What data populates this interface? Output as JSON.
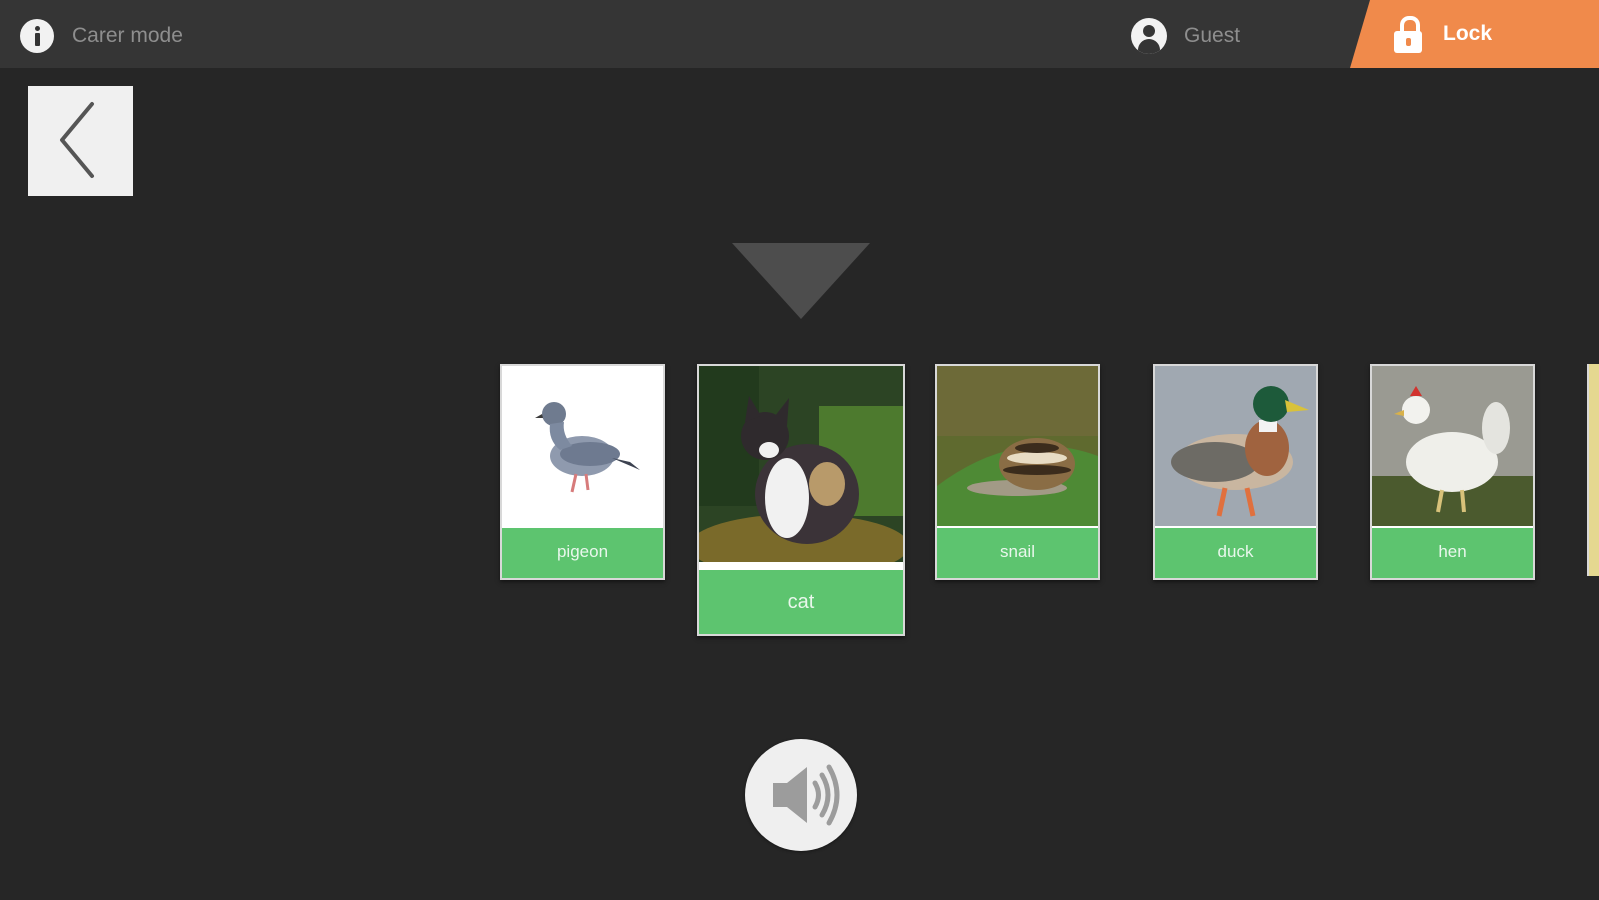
{
  "topbar": {
    "info_label": "Carer mode",
    "user_label": "Guest",
    "lock_label": "Lock"
  },
  "cards": [
    {
      "label": "pigeon",
      "icon": "pigeon-photo"
    },
    {
      "label": "cat",
      "icon": "cat-photo",
      "selected": true
    },
    {
      "label": "snail",
      "icon": "snail-photo"
    },
    {
      "label": "duck",
      "icon": "duck-photo"
    },
    {
      "label": "hen",
      "icon": "hen-photo"
    }
  ],
  "colors": {
    "background": "#262626",
    "topbar": "#353535",
    "lock_accent": "#f08a4b",
    "caption_green": "#5dc46f"
  }
}
